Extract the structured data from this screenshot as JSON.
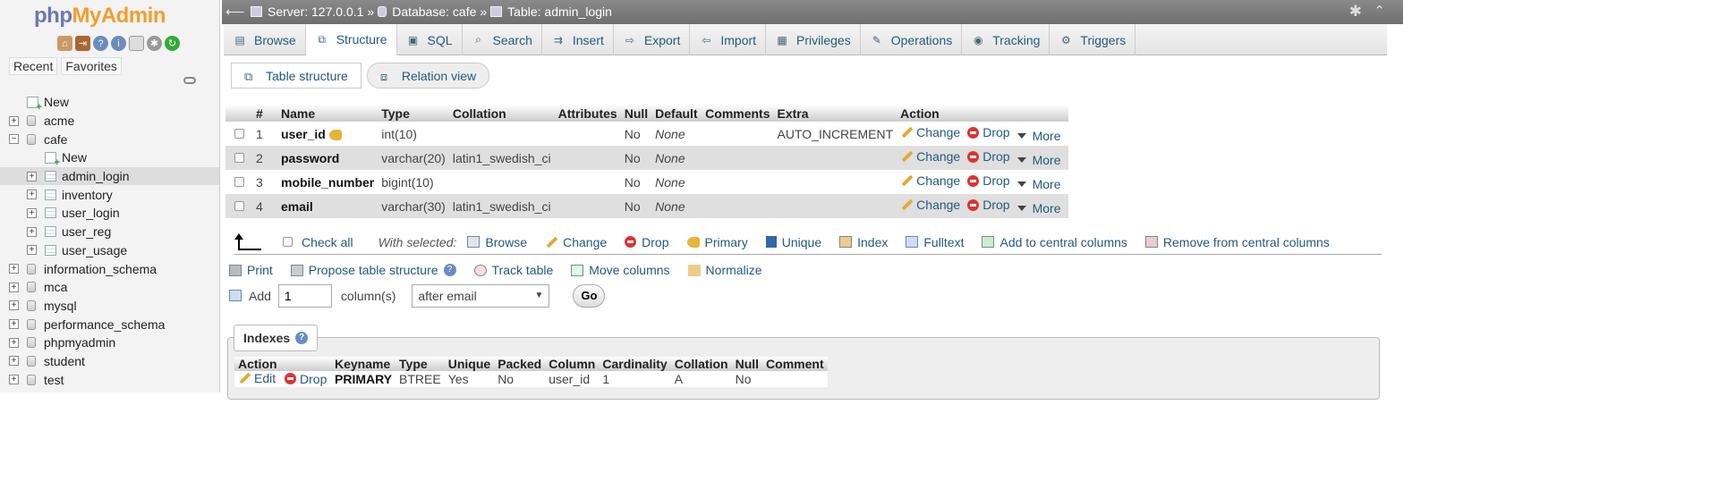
{
  "nav": {
    "logo_php": "php",
    "logo_myadmin": "MyAdmin",
    "tabs": [
      "Recent",
      "Favorites"
    ],
    "tree": [
      {
        "label": "New",
        "type": "new"
      },
      {
        "label": "acme",
        "type": "db"
      },
      {
        "label": "cafe",
        "type": "db",
        "expanded": true
      },
      {
        "label": "New",
        "type": "new-sub"
      },
      {
        "label": "admin_login",
        "type": "table",
        "selected": true
      },
      {
        "label": "inventory",
        "type": "table"
      },
      {
        "label": "user_login",
        "type": "table"
      },
      {
        "label": "user_reg",
        "type": "table"
      },
      {
        "label": "user_usage",
        "type": "table"
      },
      {
        "label": "information_schema",
        "type": "db"
      },
      {
        "label": "mca",
        "type": "db"
      },
      {
        "label": "mysql",
        "type": "db"
      },
      {
        "label": "performance_schema",
        "type": "db"
      },
      {
        "label": "phpmyadmin",
        "type": "db"
      },
      {
        "label": "student",
        "type": "db"
      },
      {
        "label": "test",
        "type": "db"
      }
    ]
  },
  "breadcrumb": {
    "server": "Server: 127.0.0.1",
    "sep1": "»",
    "database": "Database: cafe",
    "sep2": "»",
    "table": "Table: admin_login"
  },
  "tabs": [
    {
      "label": "Browse",
      "icon": "browse-icon"
    },
    {
      "label": "Structure",
      "icon": "structure-icon",
      "active": true
    },
    {
      "label": "SQL",
      "icon": "sql-icon"
    },
    {
      "label": "Search",
      "icon": "search-icon"
    },
    {
      "label": "Insert",
      "icon": "insert-icon"
    },
    {
      "label": "Export",
      "icon": "export-icon"
    },
    {
      "label": "Import",
      "icon": "import-icon"
    },
    {
      "label": "Privileges",
      "icon": "privileges-icon"
    },
    {
      "label": "Operations",
      "icon": "operations-icon"
    },
    {
      "label": "Tracking",
      "icon": "tracking-icon"
    },
    {
      "label": "Triggers",
      "icon": "triggers-icon"
    }
  ],
  "subtabs": {
    "table_structure": "Table structure",
    "relation_view": "Relation view"
  },
  "structure": {
    "headers": [
      "#",
      "Name",
      "Type",
      "Collation",
      "Attributes",
      "Null",
      "Default",
      "Comments",
      "Extra",
      "Action"
    ],
    "rows": [
      {
        "num": "1",
        "name": "user_id",
        "primary": true,
        "type": "int(10)",
        "collation": "",
        "attributes": "",
        "null": "No",
        "default": "None",
        "comments": "",
        "extra": "AUTO_INCREMENT"
      },
      {
        "num": "2",
        "name": "password",
        "type": "varchar(20)",
        "collation": "latin1_swedish_ci",
        "attributes": "",
        "null": "No",
        "default": "None",
        "comments": "",
        "extra": ""
      },
      {
        "num": "3",
        "name": "mobile_number",
        "type": "bigint(10)",
        "collation": "",
        "attributes": "",
        "null": "No",
        "default": "None",
        "comments": "",
        "extra": ""
      },
      {
        "num": "4",
        "name": "email",
        "type": "varchar(30)",
        "collation": "latin1_swedish_ci",
        "attributes": "",
        "null": "No",
        "default": "None",
        "comments": "",
        "extra": ""
      }
    ],
    "actions": {
      "change": "Change",
      "drop": "Drop",
      "more": "More"
    }
  },
  "with_selected": {
    "check_all": "Check all",
    "label": "With selected:",
    "browse": "Browse",
    "change": "Change",
    "drop": "Drop",
    "primary": "Primary",
    "unique": "Unique",
    "index": "Index",
    "fulltext": "Fulltext",
    "add_central": "Add to central columns",
    "remove_central": "Remove from central columns"
  },
  "links": {
    "print": "Print",
    "propose": "Propose table structure",
    "track": "Track table",
    "move": "Move columns",
    "normalize": "Normalize"
  },
  "add_columns": {
    "label": "Add",
    "value": "1",
    "unit": "column(s)",
    "position": "after email",
    "go": "Go"
  },
  "indexes": {
    "title": "Indexes",
    "headers": [
      "Action",
      "Keyname",
      "Type",
      "Unique",
      "Packed",
      "Column",
      "Cardinality",
      "Collation",
      "Null",
      "Comment"
    ],
    "row": {
      "edit": "Edit",
      "drop": "Drop",
      "keyname": "PRIMARY",
      "type": "BTREE",
      "unique": "Yes",
      "packed": "No",
      "column": "user_id",
      "cardinality": "1",
      "collation": "A",
      "null": "No",
      "comment": ""
    }
  }
}
